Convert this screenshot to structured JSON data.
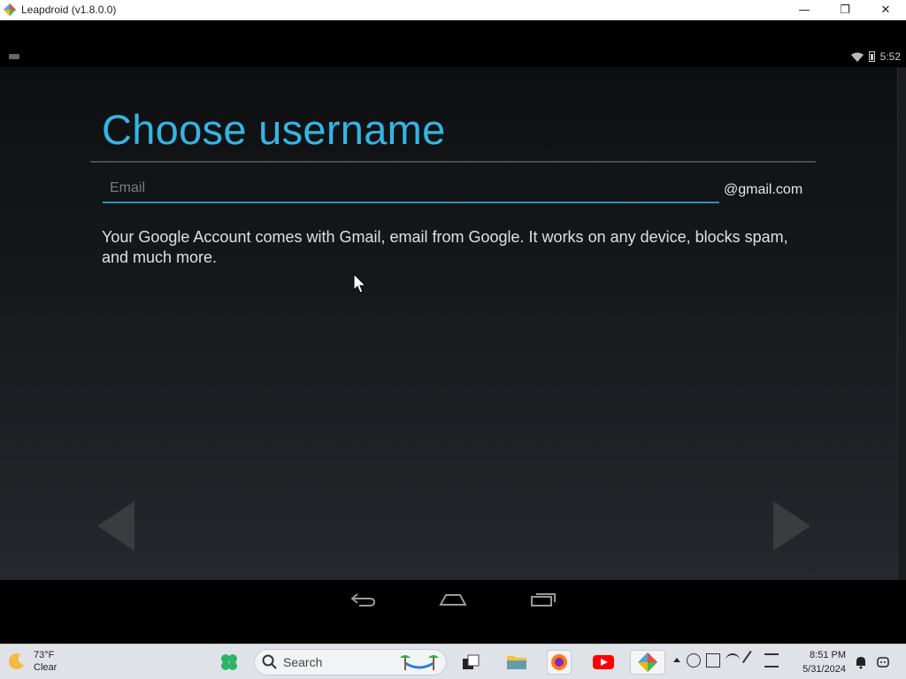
{
  "window": {
    "title": "Leapdroid (v1.8.0.0)",
    "minimize": "—",
    "restore": "❐",
    "close": "✕"
  },
  "statusbar": {
    "time": "5:52"
  },
  "setup": {
    "heading": "Choose username",
    "email_placeholder": "Email",
    "email_value": "",
    "email_suffix": "@gmail.com",
    "description": "Your Google Account comes with Gmail, email from Google. It works on any device, blocks spam, and much more."
  },
  "colors": {
    "accent": "#33b5e5",
    "underline": "#2f8fbf"
  },
  "taskbar": {
    "weather_temp": "73°F",
    "weather_cond": "Clear",
    "search_label": "Search",
    "time": "8:51 PM",
    "date": "5/31/2024"
  }
}
